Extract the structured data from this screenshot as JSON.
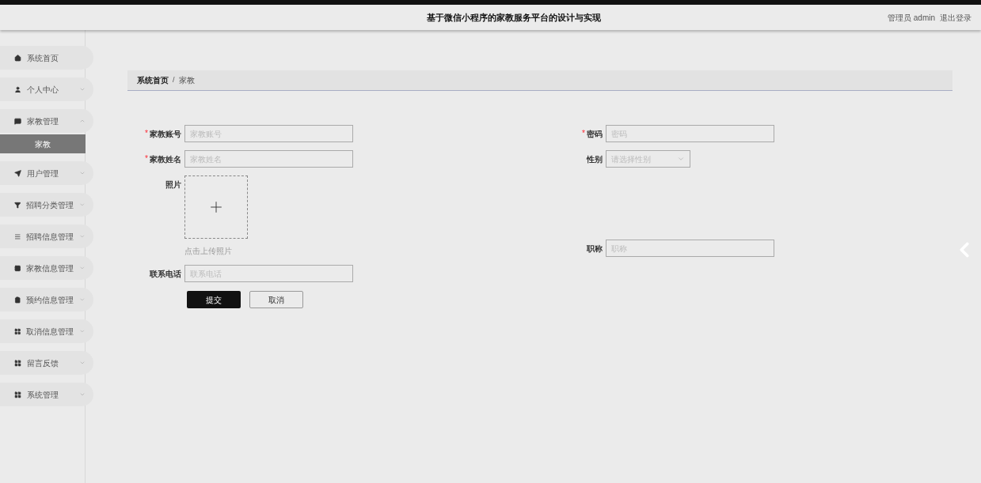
{
  "header": {
    "title": "基于微信小程序的家教服务平台的设计与实现",
    "user": "管理员 admin",
    "logout": "退出登录"
  },
  "sidebar": {
    "items": [
      {
        "label": "系统首页",
        "kind": "link"
      },
      {
        "label": "个人中心",
        "kind": "menu",
        "expanded": false
      },
      {
        "label": "家教管理",
        "kind": "menu",
        "expanded": true,
        "children": [
          {
            "label": "家教",
            "selected": true
          }
        ]
      },
      {
        "label": "用户管理",
        "kind": "menu",
        "expanded": false
      },
      {
        "label": "招聘分类管理",
        "kind": "menu",
        "expanded": false
      },
      {
        "label": "招聘信息管理",
        "kind": "menu",
        "expanded": false
      },
      {
        "label": "家教信息管理",
        "kind": "menu",
        "expanded": false
      },
      {
        "label": "预约信息管理",
        "kind": "menu",
        "expanded": false
      },
      {
        "label": "取消信息管理",
        "kind": "menu",
        "expanded": false
      },
      {
        "label": "留言反馈",
        "kind": "menu",
        "expanded": false
      },
      {
        "label": "系统管理",
        "kind": "menu",
        "expanded": false
      }
    ]
  },
  "breadcrumb": {
    "items": [
      "系统首页",
      "家教"
    ],
    "separator": "/"
  },
  "form": {
    "rows": [
      [
        {
          "kind": "text",
          "label": "家教账号",
          "required_mark": "*",
          "placeholder": "家教账号"
        },
        {
          "kind": "text",
          "label": "密码",
          "required_mark": "*",
          "placeholder": "密码"
        }
      ],
      [
        {
          "kind": "text",
          "label": "家教姓名",
          "required_mark": "*",
          "placeholder": "家教姓名"
        },
        {
          "kind": "select",
          "label": "性别",
          "placeholder": "请选择性别"
        }
      ],
      [
        {
          "kind": "upload",
          "label": "照片",
          "hint": "点击上传照片"
        },
        {
          "kind": "text",
          "label": "职称",
          "placeholder": "职称"
        }
      ],
      [
        {
          "kind": "text",
          "label": "联系电话",
          "placeholder": "联系电话"
        }
      ]
    ],
    "buttons": [
      {
        "label": "提交",
        "kind": "primary"
      },
      {
        "label": "取消",
        "kind": "secondary"
      }
    ]
  }
}
